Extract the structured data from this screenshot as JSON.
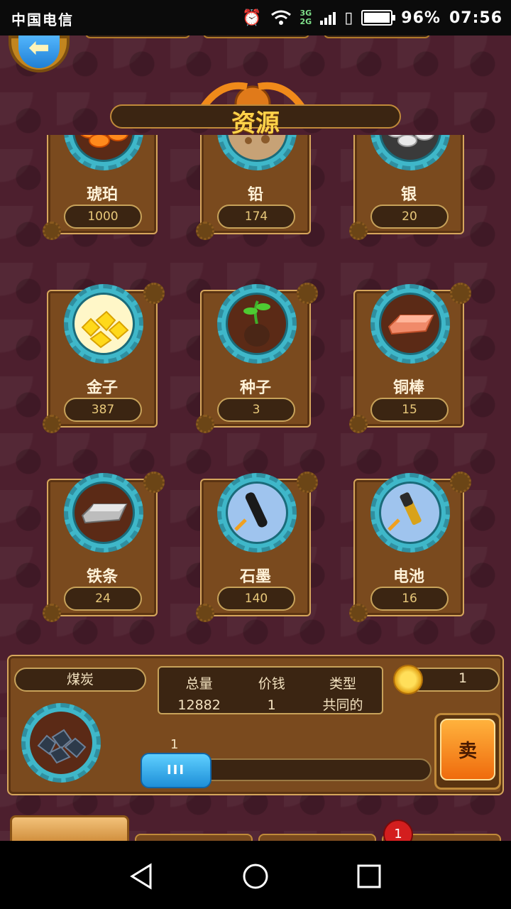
{
  "status_bar": {
    "carrier": "中国电信",
    "net_top": "3G",
    "net_bottom": "2G",
    "battery": "96%",
    "time": "07:56"
  },
  "header": {
    "back_icon": "arrow-left-icon",
    "title": "资源"
  },
  "resources": [
    {
      "name": "琥珀",
      "quantity": "1000",
      "icon": "amber-icon"
    },
    {
      "name": "铅",
      "quantity": "174",
      "icon": "lead-icon"
    },
    {
      "name": "银",
      "quantity": "20",
      "icon": "silver-icon"
    },
    {
      "name": "金子",
      "quantity": "387",
      "icon": "gold-icon"
    },
    {
      "name": "种子",
      "quantity": "3",
      "icon": "seed-icon"
    },
    {
      "name": "铜棒",
      "quantity": "15",
      "icon": "copper-bar-icon"
    },
    {
      "name": "铁条",
      "quantity": "24",
      "icon": "iron-bar-icon"
    },
    {
      "name": "石墨",
      "quantity": "140",
      "icon": "graphite-icon"
    },
    {
      "name": "电池",
      "quantity": "16",
      "icon": "battery-icon"
    }
  ],
  "selected": {
    "name": "煤炭",
    "icon": "coal-icon",
    "stats": [
      {
        "label": "总量",
        "value": "12882"
      },
      {
        "label": "价钱",
        "value": "1"
      },
      {
        "label": "类型",
        "value": "共同的"
      }
    ],
    "coin_value": "1",
    "slider_value": "1",
    "slider_grip": "III",
    "sell_label": "卖"
  },
  "bottom_tabs": {
    "notification_count": "1"
  }
}
